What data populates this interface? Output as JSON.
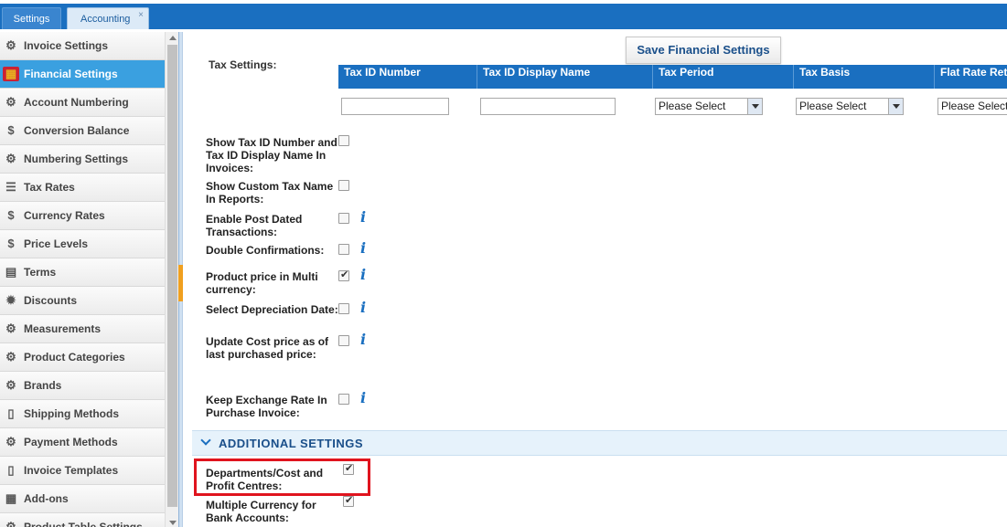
{
  "tabs": [
    {
      "label": "Settings"
    },
    {
      "label": "Accounting",
      "close": "×"
    }
  ],
  "sidebar": {
    "items": [
      {
        "label": "Invoice Settings",
        "icon": "⚙"
      },
      {
        "label": "Financial Settings",
        "icon": "▦",
        "active": true
      },
      {
        "label": "Account Numbering",
        "icon": "⚙"
      },
      {
        "label": "Conversion Balance",
        "icon": "$"
      },
      {
        "label": "Numbering Settings",
        "icon": "⚙"
      },
      {
        "label": "Tax Rates",
        "icon": "☰"
      },
      {
        "label": "Currency Rates",
        "icon": "$"
      },
      {
        "label": "Price Levels",
        "icon": "$"
      },
      {
        "label": "Terms",
        "icon": "▤"
      },
      {
        "label": "Discounts",
        "icon": "✹"
      },
      {
        "label": "Measurements",
        "icon": "⚙"
      },
      {
        "label": "Product Categories",
        "icon": "⚙"
      },
      {
        "label": "Brands",
        "icon": "⚙"
      },
      {
        "label": "Shipping Methods",
        "icon": "▯"
      },
      {
        "label": "Payment Methods",
        "icon": "⚙"
      },
      {
        "label": "Invoice Templates",
        "icon": "▯"
      },
      {
        "label": "Add-ons",
        "icon": "▦"
      },
      {
        "label": "Product Table Settings",
        "icon": "⚙"
      }
    ]
  },
  "toolbar": {
    "save_label": "Save Financial Settings"
  },
  "tax_settings": {
    "label": "Tax Settings:",
    "columns": [
      "Tax ID Number",
      "Tax ID Display Name",
      "Tax Period",
      "Tax Basis",
      "Flat Rate Ret"
    ],
    "tax_id_number": "",
    "tax_id_display_name": "",
    "tax_period": "Please Select",
    "tax_basis": "Please Select",
    "flat_rate": "Please Select"
  },
  "options": [
    {
      "label": "Show Tax ID Number and Tax ID Display Name In Invoices:",
      "checked": false,
      "info": false
    },
    {
      "label": "Show Custom Tax Name In Reports:",
      "checked": false,
      "info": false
    },
    {
      "label": "Enable Post Dated Transactions:",
      "checked": false,
      "info": true
    },
    {
      "label": "Double Confirmations:",
      "checked": false,
      "info": true
    },
    {
      "label": "Product price in Multi currency:",
      "checked": true,
      "info": true
    },
    {
      "label": "Select Depreciation Date:",
      "checked": false,
      "info": true
    },
    {
      "label": "Update Cost price as of last purchased price:",
      "checked": false,
      "info": true
    },
    {
      "label": "Keep Exchange Rate In Purchase Invoice:",
      "checked": false,
      "info": true
    }
  ],
  "additional": {
    "title": "ADDITIONAL SETTINGS",
    "options": [
      {
        "label": "Departments/Cost and Profit Centres:",
        "checked": true
      },
      {
        "label": "Multiple Currency for Bank Accounts:",
        "checked": true
      }
    ]
  },
  "info_glyph": "i",
  "colors": {
    "accent": "#1a6fc0",
    "active_item": "#3aa0e0",
    "highlight": "#e0141e"
  }
}
